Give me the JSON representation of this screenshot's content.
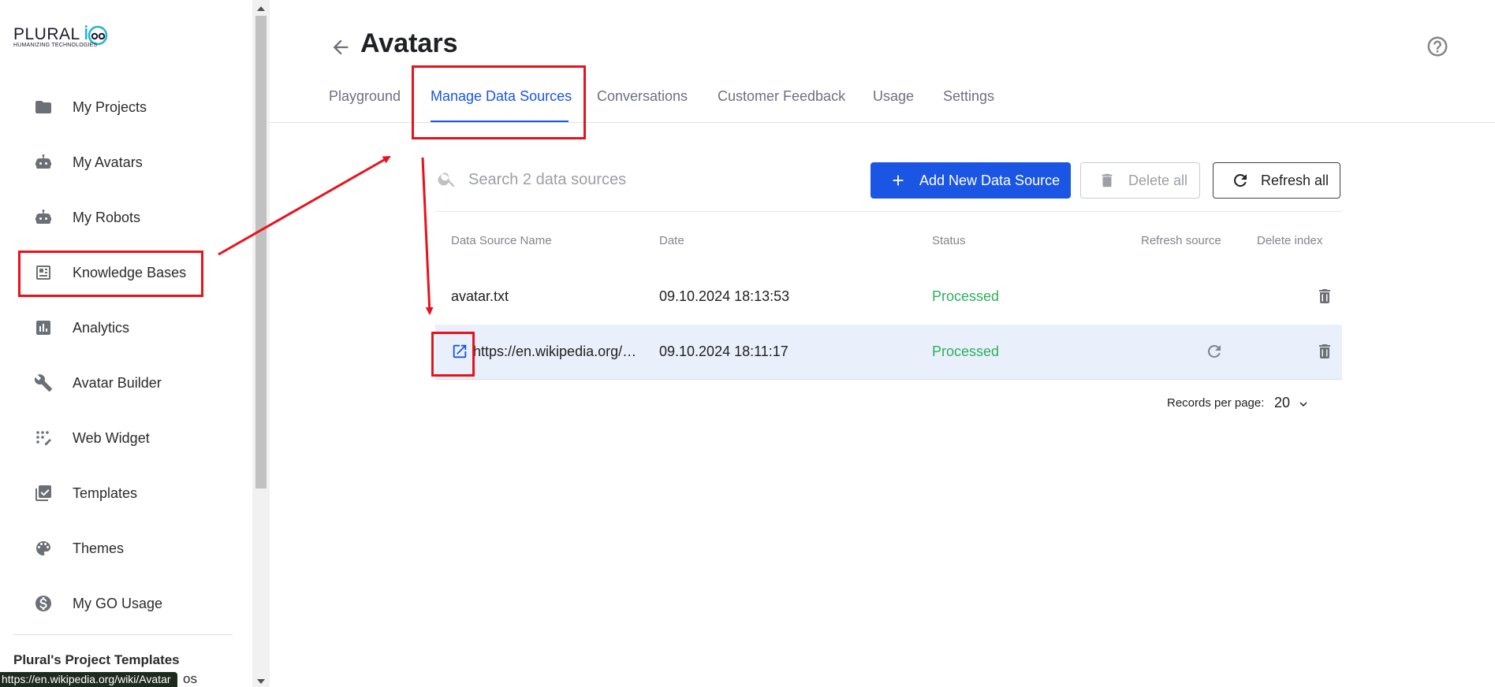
{
  "sidebar": {
    "logo_text": "PLURAL",
    "logo_tagline": "HUMANIZING TECHNOLOGIES",
    "items": [
      {
        "label": "My Projects",
        "icon": "folder-icon"
      },
      {
        "label": "My Avatars",
        "icon": "robot-icon"
      },
      {
        "label": "My Robots",
        "icon": "robot-icon"
      },
      {
        "label": "Knowledge Bases",
        "icon": "article-icon"
      },
      {
        "label": "Analytics",
        "icon": "bar-chart-icon"
      },
      {
        "label": "Avatar Builder",
        "icon": "wrench-icon"
      },
      {
        "label": "Web Widget",
        "icon": "dots-grid-icon"
      },
      {
        "label": "Templates",
        "icon": "library-check-icon"
      },
      {
        "label": "Themes",
        "icon": "palette-icon"
      },
      {
        "label": "My GO Usage",
        "icon": "dollar-circle-icon"
      }
    ],
    "section_title": "Plural's Project Templates",
    "section_sub": "os"
  },
  "status_tooltip": "https://en.wikipedia.org/wiki/Avatar",
  "header": {
    "title": "Avatars"
  },
  "tabs": [
    {
      "label": "Playground",
      "active": false
    },
    {
      "label": "Manage Data Sources",
      "active": true
    },
    {
      "label": "Conversations",
      "active": false
    },
    {
      "label": "Customer Feedback",
      "active": false
    },
    {
      "label": "Usage",
      "active": false
    },
    {
      "label": "Settings",
      "active": false
    }
  ],
  "toolbar": {
    "search_placeholder": "Search 2 data sources",
    "add_label": "Add New Data Source",
    "delete_all_label": "Delete all",
    "refresh_all_label": "Refresh all"
  },
  "table": {
    "columns": [
      "Data Source Name",
      "Date",
      "Status",
      "Refresh source",
      "Delete index"
    ],
    "rows": [
      {
        "name": "avatar.txt",
        "date": "09.10.2024 18:13:53",
        "status": "Processed",
        "is_link": false,
        "refreshable": false
      },
      {
        "name": "https://en.wikipedia.org/…",
        "date": "09.10.2024 18:11:17",
        "status": "Processed",
        "is_link": true,
        "refreshable": true
      }
    ]
  },
  "pagination": {
    "label": "Records per page:",
    "value": "20"
  },
  "colors": {
    "accent": "#1a55e3",
    "status_ok": "#2eaf5a",
    "annotation": "#e8121b",
    "row_highlight": "#eaf0fb"
  }
}
